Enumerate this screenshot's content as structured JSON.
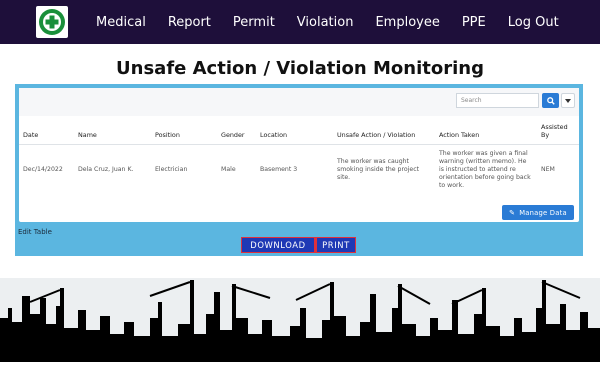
{
  "nav": {
    "logo_alt": "safety first logo",
    "items": [
      "Medical",
      "Report",
      "Permit",
      "Violation",
      "Employee",
      "PPE",
      "Log Out"
    ]
  },
  "page": {
    "title": "Unsafe Action / Violation Monitoring"
  },
  "search": {
    "placeholder": "Search"
  },
  "table": {
    "columns": [
      "Date",
      "Name",
      "Position",
      "Gender",
      "Location",
      "Unsafe Action / Violation",
      "Action Taken",
      "Assisted By"
    ],
    "rows": [
      {
        "date": "Dec/14/2022",
        "name": "Dela Cruz, Juan K.",
        "position": "Electrician",
        "gender": "Male",
        "location": "Basement 3",
        "violation": "The worker was caught smoking inside the project site.",
        "action": "The worker was given a final warning (written memo). He is instructed to attend re orientation before going back to work.",
        "assisted_by": "NEM"
      }
    ]
  },
  "actions": {
    "manage_data": "Manage Data",
    "edit_table": "Edit Table",
    "download": "DOWNLOAD",
    "print": "PRINT"
  },
  "colors": {
    "nav_bg": "#1e0f3a",
    "panel_bg": "#5bb6e0",
    "primary": "#2a7bd5",
    "download_bg": "#1f39b5",
    "download_border": "#e0303a"
  },
  "icons": [
    "safety-logo",
    "search-icon",
    "caret-down-icon",
    "pencil-icon"
  ]
}
